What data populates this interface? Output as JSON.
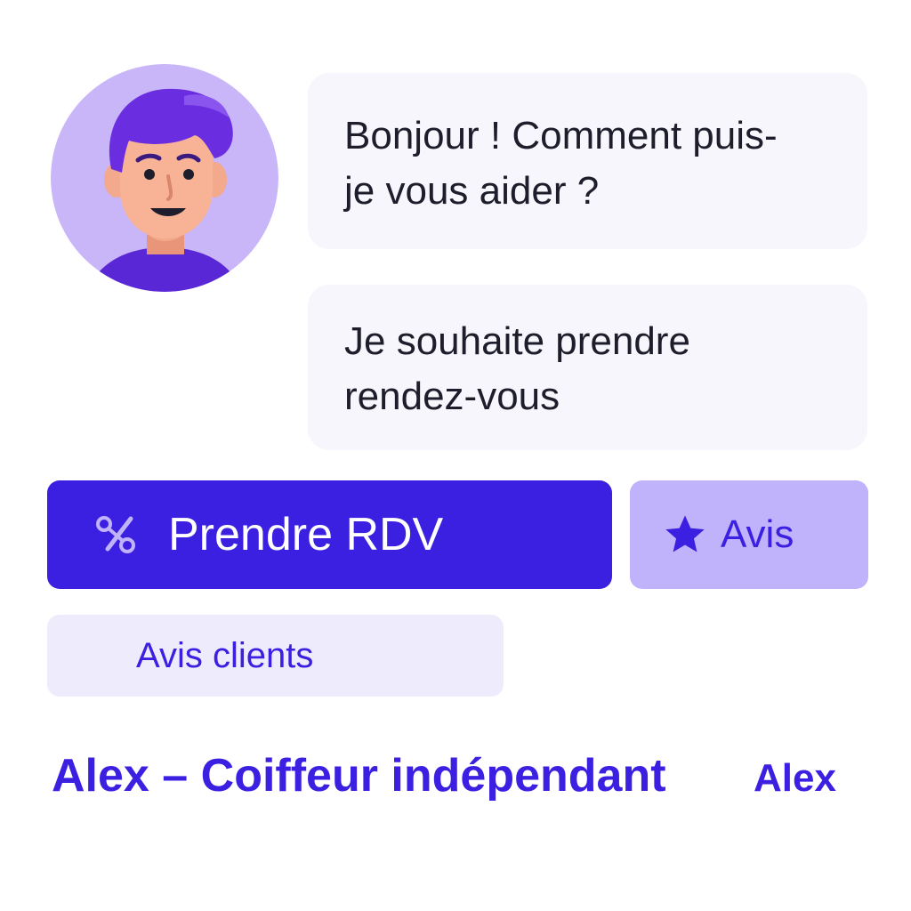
{
  "chat": {
    "messages": [
      {
        "lines": [
          "Bonjour ! Comment puis-",
          "je vous aider ?"
        ]
      },
      {
        "lines": [
          "Je souhaite prendre",
          "rendez-vous"
        ]
      }
    ]
  },
  "actions": {
    "book": {
      "label": "Prendre RDV",
      "icon": "scissors-icon"
    },
    "reviews": {
      "label": "Avis",
      "icon": "star-icon"
    },
    "client_reviews": {
      "label": "Avis clients"
    }
  },
  "footer": {
    "title": "Alex – Coiffeur indépendant",
    "name": "Alex"
  },
  "colors": {
    "accent": "#3b20e2",
    "accent_light": "#c0b2fb",
    "accent_pale": "#eeebfd",
    "bubble_bg": "#f7f6fc"
  }
}
